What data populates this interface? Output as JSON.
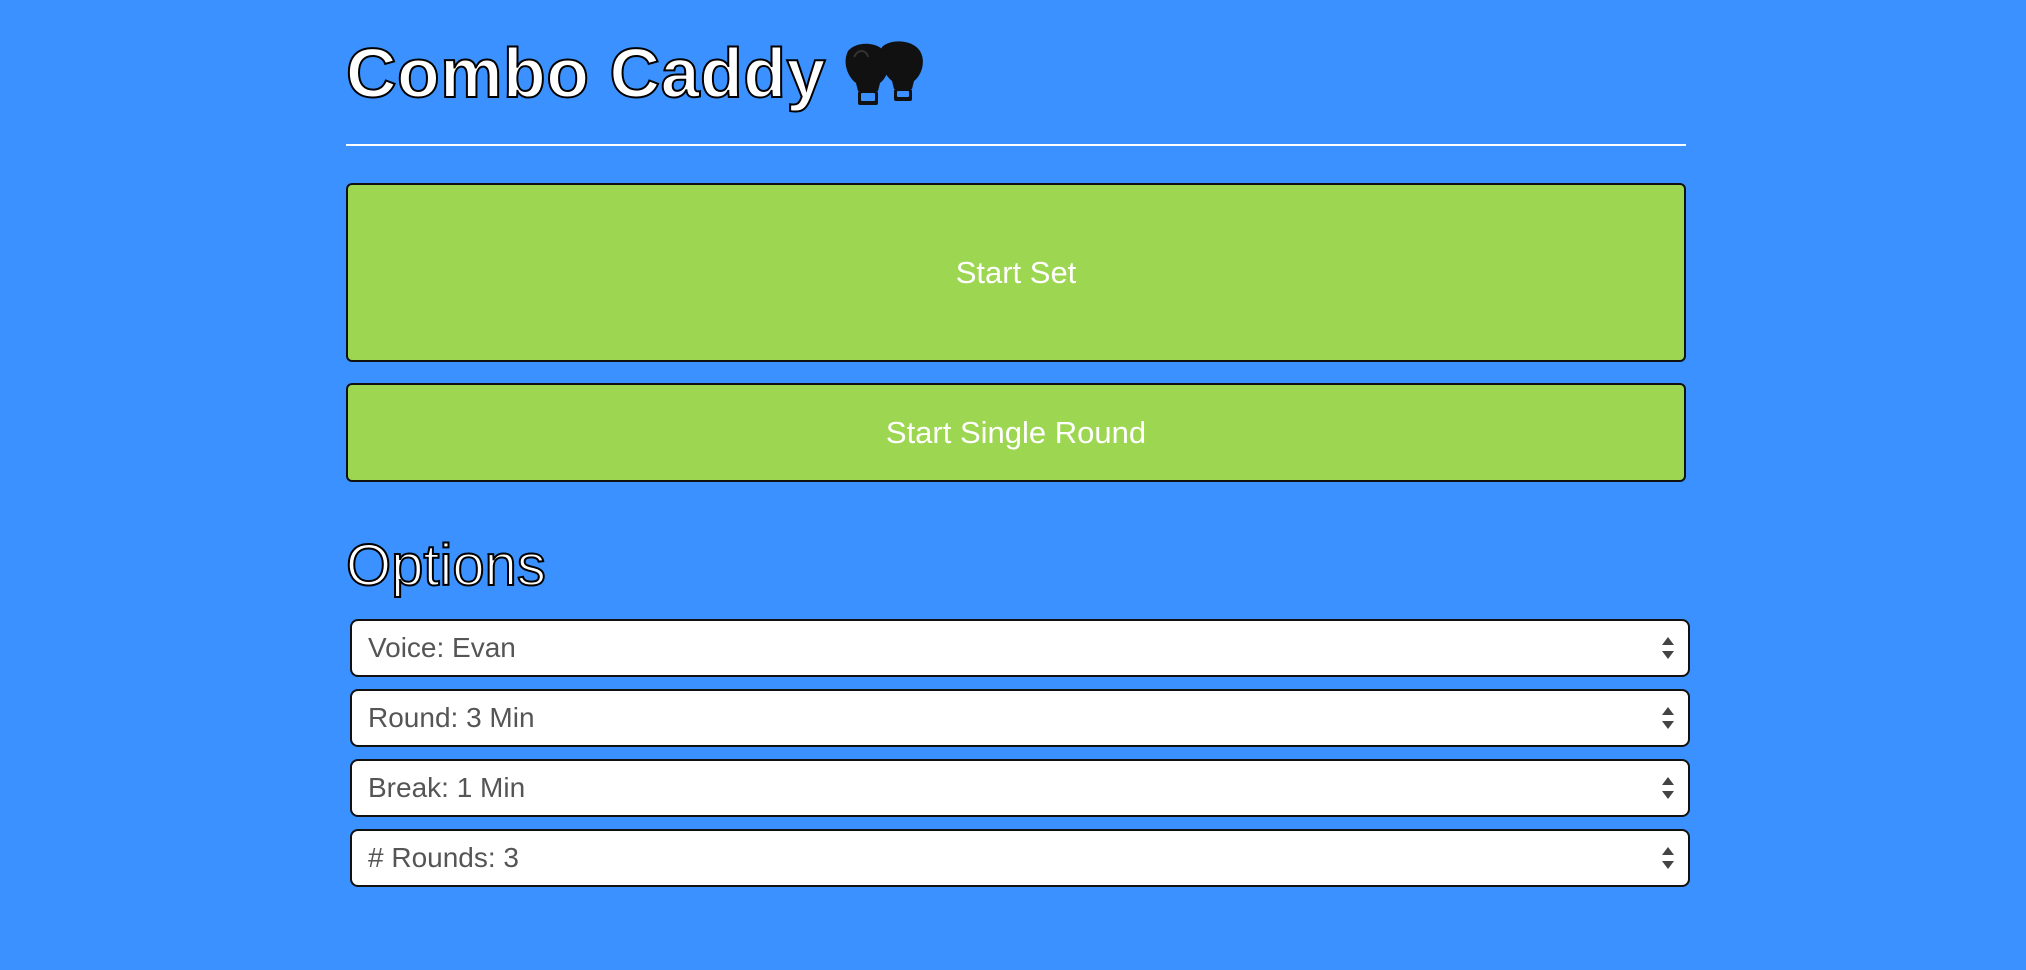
{
  "header": {
    "title": "Combo Caddy",
    "icon": "boxing-gloves-icon"
  },
  "actions": {
    "start_set_label": "Start Set",
    "start_single_round_label": "Start Single Round"
  },
  "options": {
    "heading": "Options",
    "voice": "Voice: Evan",
    "round": "Round: 3 Min",
    "break": "Break: 1 Min",
    "rounds": "# Rounds: 3"
  },
  "colors": {
    "background": "#3a91ff",
    "button": "#9dd650",
    "select_text": "#555555"
  }
}
